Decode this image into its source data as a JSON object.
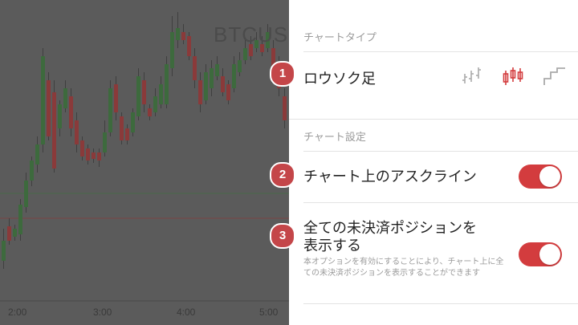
{
  "chart": {
    "symbol": "BTCUSD",
    "time_labels": [
      "2:00",
      "3:00",
      "4:00",
      "5:00"
    ],
    "colors": {
      "up": "#3d6a3d",
      "down": "#8a3a3a",
      "bg": "#5b5b5b"
    }
  },
  "panel": {
    "chart_type_header": "チャートタイプ",
    "chart_type_label": "ロウソク足",
    "chart_type_options": [
      "line-chart-icon",
      "candlestick-icon",
      "step-chart-icon"
    ],
    "settings_header": "チャート設定",
    "ask_line_label": "チャート上のアスクライン",
    "ask_line_enabled": true,
    "positions_label_line1": "全ての未決済ポジションを",
    "positions_label_line2": "表示する",
    "positions_desc": "本オプションを有効にすることにより、チャート上に全ての未決済ポジションを表示することができます",
    "positions_enabled": true,
    "accent_color": "#d33c3e"
  },
  "badges": [
    "1",
    "2",
    "3"
  ]
}
